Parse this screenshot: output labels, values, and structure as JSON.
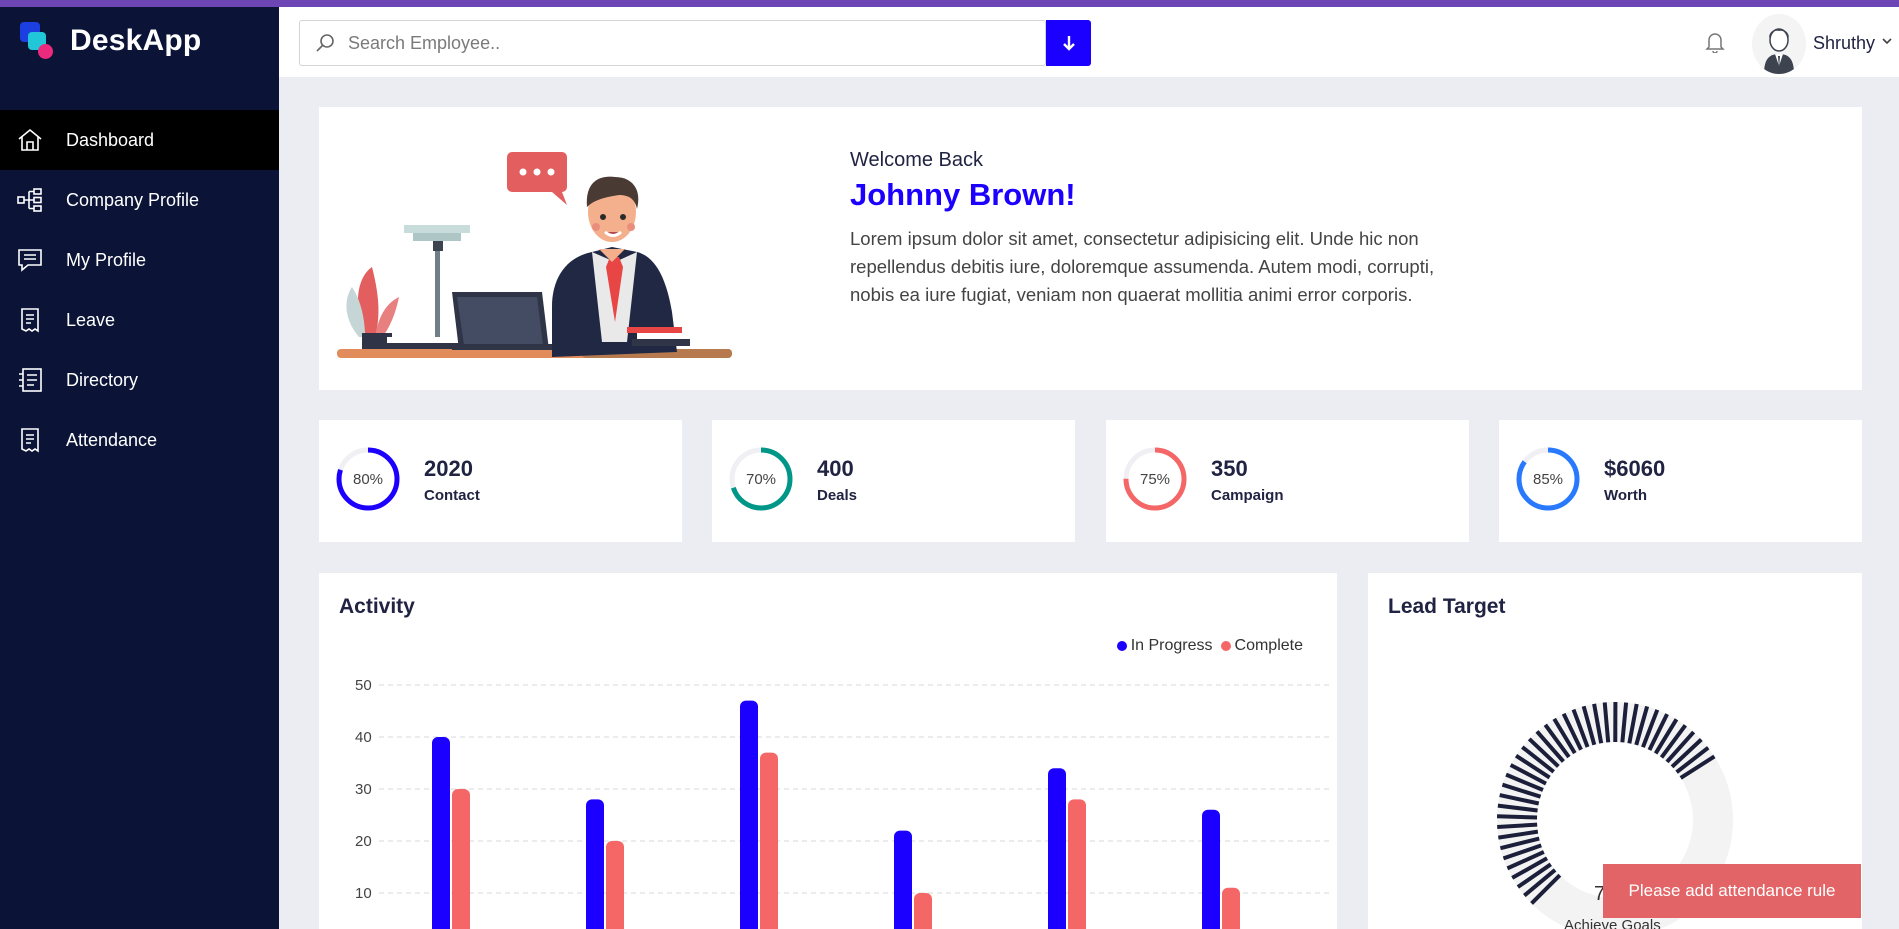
{
  "app": {
    "name": "DeskApp"
  },
  "sidebar": {
    "items": [
      {
        "label": "Dashboard",
        "icon": "home-icon",
        "active": true
      },
      {
        "label": "Company Profile",
        "icon": "org-chart-icon"
      },
      {
        "label": "My Profile",
        "icon": "chat-icon"
      },
      {
        "label": "Leave",
        "icon": "receipt-icon"
      },
      {
        "label": "Directory",
        "icon": "directory-icon"
      },
      {
        "label": "Attendance",
        "icon": "receipt-icon"
      }
    ]
  },
  "header": {
    "search_placeholder": "Search Employee..",
    "username": "Shruthy"
  },
  "welcome": {
    "greeting": "Welcome Back",
    "name": "Johnny Brown!",
    "text": "Lorem ipsum dolor sit amet, consectetur adipisicing elit. Unde hic non repellendus debitis iure, doloremque assumenda. Autem modi, corrupti, nobis ea iure fugiat, veniam non quaerat mollitia animi error corporis."
  },
  "stats": [
    {
      "percent": 80,
      "percent_label": "80%",
      "value": "2020",
      "label": "Contact",
      "color": "#1b00ff"
    },
    {
      "percent": 70,
      "percent_label": "70%",
      "value": "400",
      "label": "Deals",
      "color": "#009688"
    },
    {
      "percent": 75,
      "percent_label": "75%",
      "value": "350",
      "label": "Campaign",
      "color": "#f56767"
    },
    {
      "percent": 85,
      "percent_label": "85%",
      "value": "$6060",
      "label": "Worth",
      "color": "#2979ff"
    }
  ],
  "activity": {
    "title": "Activity",
    "legend": [
      {
        "name": "In Progress",
        "color": "#1b00ff"
      },
      {
        "name": "Complete",
        "color": "#f56767"
      }
    ]
  },
  "chart_data": {
    "type": "bar",
    "categories": [
      "",
      "",
      "",
      "",
      "",
      ""
    ],
    "series": [
      {
        "name": "In Progress",
        "values": [
          40,
          28,
          47,
          22,
          34,
          26
        ],
        "color": "#1b00ff"
      },
      {
        "name": "Complete",
        "values": [
          30,
          20,
          37,
          10,
          28,
          11
        ],
        "color": "#f56767"
      }
    ],
    "yticks": [
      10,
      20,
      30,
      40,
      50
    ],
    "ylim": [
      0,
      50
    ],
    "grid": true,
    "legend_position": "top-right"
  },
  "lead": {
    "title": "Lead Target",
    "percent": 73,
    "percent_label": "73%",
    "sub": "Achieve Goals"
  },
  "toast": {
    "text": "Please add attendance rule",
    "color": "#e36466"
  }
}
